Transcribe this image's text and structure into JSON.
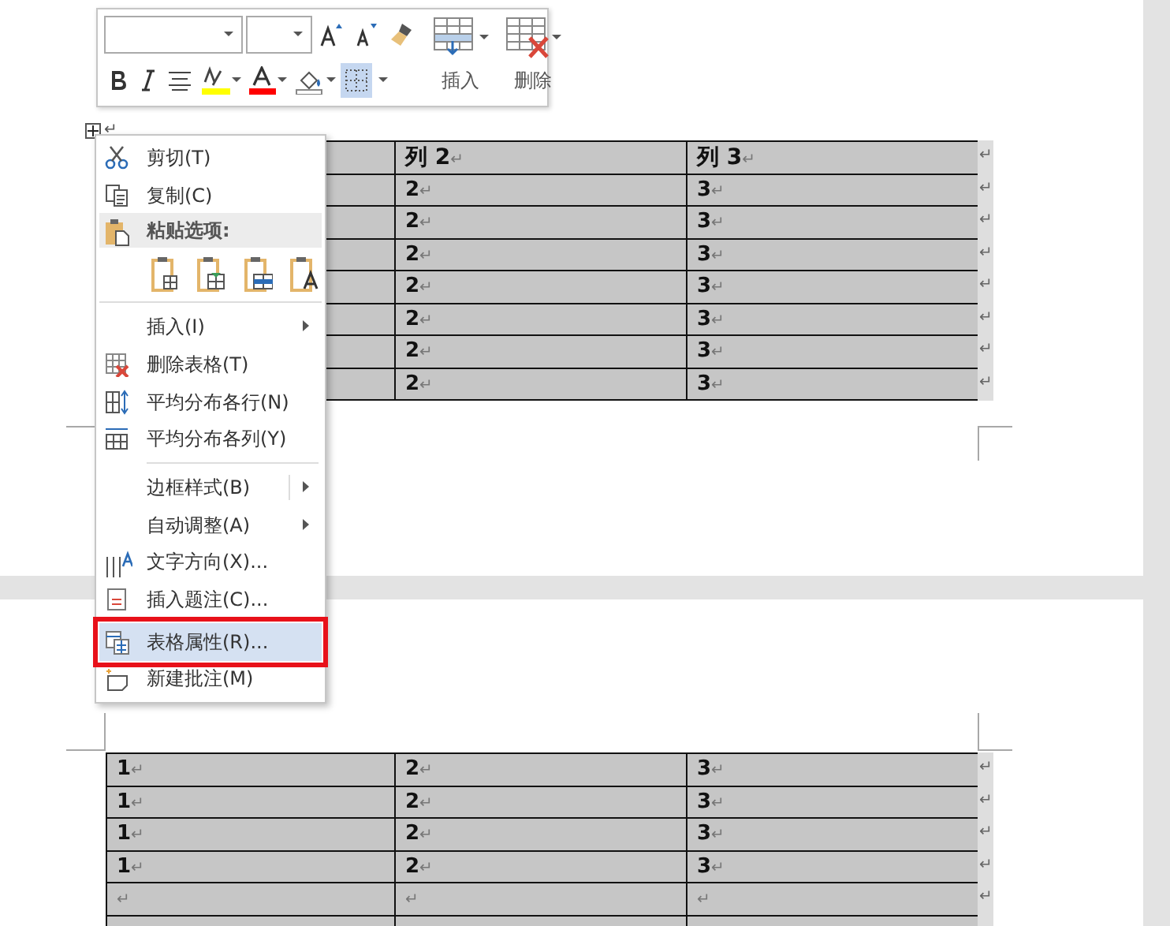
{
  "toolbar": {
    "insert_label": "插入",
    "delete_label": "删除",
    "borders_selected": true
  },
  "paragraph_mark": "↵",
  "table_1": {
    "rows": [
      {
        "cells": [
          null,
          "列 2↵",
          "列 3↵"
        ],
        "end": "↵",
        "header": true
      },
      {
        "cells": [
          null,
          "2↵",
          "3↵"
        ],
        "end": "↵",
        "header": false
      },
      {
        "cells": [
          null,
          "2↵",
          "3↵"
        ],
        "end": "↵",
        "header": false
      },
      {
        "cells": [
          null,
          "2↵",
          "3↵"
        ],
        "end": "↵",
        "header": false
      },
      {
        "cells": [
          null,
          "2↵",
          "3↵"
        ],
        "end": "↵",
        "header": false
      },
      {
        "cells": [
          null,
          "2↵",
          "3↵"
        ],
        "end": "↵",
        "header": false
      },
      {
        "cells": [
          null,
          "2↵",
          "3↵"
        ],
        "end": "↵",
        "header": false
      },
      {
        "cells": [
          null,
          "2↵",
          "3↵"
        ],
        "end": "↵",
        "header": false
      }
    ]
  },
  "table_2": {
    "rows": [
      {
        "cells": [
          "1↵",
          "2↵",
          "3↵"
        ],
        "end": "↵"
      },
      {
        "cells": [
          "1↵",
          "2↵",
          "3↵"
        ],
        "end": "↵"
      },
      {
        "cells": [
          "1↵",
          "2↵",
          "3↵"
        ],
        "end": "↵"
      },
      {
        "cells": [
          "1↵",
          "2↵",
          "3↵"
        ],
        "end": "↵"
      },
      {
        "cells": [
          "↵",
          "↵",
          "↵"
        ],
        "end": "↵"
      },
      {
        "cells": [
          null,
          null,
          null
        ]
      }
    ]
  },
  "context_menu": [
    {
      "kind": "item",
      "label": "剪切(T)",
      "submenu": false,
      "selected": false
    },
    {
      "kind": "item",
      "label": "复制(C)",
      "submenu": false,
      "selected": false
    },
    {
      "kind": "header",
      "label": "粘贴选项:"
    },
    {
      "kind": "paste-options"
    },
    {
      "kind": "item",
      "label": "插入(I)",
      "submenu": true,
      "selected": false
    },
    {
      "kind": "item",
      "label": "删除表格(T)",
      "submenu": false,
      "selected": false
    },
    {
      "kind": "item",
      "label": "平均分布各行(N)",
      "submenu": false,
      "selected": false
    },
    {
      "kind": "item",
      "label": "平均分布各列(Y)",
      "submenu": false,
      "selected": false
    },
    {
      "kind": "separator"
    },
    {
      "kind": "item",
      "label": "边框样式(B)",
      "submenu": true,
      "split": true,
      "selected": false
    },
    {
      "kind": "item",
      "label": "自动调整(A)",
      "submenu": true,
      "selected": false
    },
    {
      "kind": "item",
      "label": "文字方向(X)...",
      "submenu": false,
      "selected": false
    },
    {
      "kind": "item",
      "label": "插入题注(C)...",
      "submenu": false,
      "selected": false
    },
    {
      "kind": "item",
      "label": "表格属性(R)...",
      "submenu": false,
      "selected": true,
      "outlined": true
    },
    {
      "kind": "item",
      "label": "新建批注(M)",
      "submenu": false,
      "selected": false
    }
  ]
}
